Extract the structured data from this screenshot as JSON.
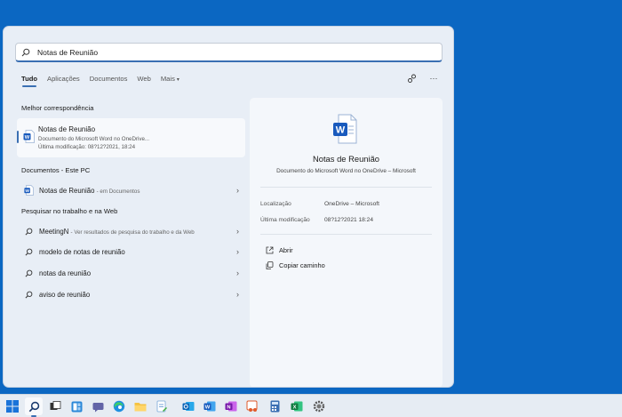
{
  "search": {
    "value": "Notas de Reunião",
    "placeholder": ""
  },
  "tabs": [
    {
      "label": "Tudo",
      "active": true
    },
    {
      "label": "Aplicações"
    },
    {
      "label": "Documentos"
    },
    {
      "label": "Web"
    },
    {
      "label": "Mais",
      "icon": "chevron-down-icon"
    }
  ],
  "tools": {
    "share_icon": "share-results-icon",
    "more_icon": "more-options-icon",
    "more_glyph": "···"
  },
  "best_match": {
    "heading": "Melhor correspondência",
    "title": "Notas de Reunião",
    "subtitle": "Documento do Microsoft Word no OneDrive...",
    "modified": "Última modificação: 08?12?2021, 18:24"
  },
  "documents": {
    "heading": "Documentos - Este PC",
    "item_title": "Notas de Reunião",
    "item_location": "- em Documentos"
  },
  "web": {
    "heading": "Pesquisar no trabalho e na Web",
    "items": [
      {
        "text": "MeetingN",
        "suffix": "- Ver resultados de pesquisa do trabalho e da Web"
      },
      {
        "text": "modelo de notas de reunião",
        "suffix": ""
      },
      {
        "text": "notas da reunião",
        "suffix": ""
      },
      {
        "text": "aviso de reunião",
        "suffix": ""
      }
    ]
  },
  "preview": {
    "title": "Notas de Reunião",
    "subtitle": "Documento do Microsoft Word no OneDrive – Microsoft",
    "location_label": "Localização",
    "location_value": "OneDrive – Microsoft",
    "modified_label": "Última modificação",
    "modified_value": "08?12?2021 18:24",
    "actions": [
      {
        "label": "Abrir",
        "icon": "open-icon"
      },
      {
        "label": "Copiar caminho",
        "icon": "copy-path-icon"
      }
    ]
  },
  "colors": {
    "desktop": "#0b67c2",
    "accent": "#3a6fb3",
    "word_blue": "#185abd",
    "excel_green": "#107c41",
    "onenote_purple": "#7719aa"
  },
  "taskbar": [
    "windows-start-icon",
    "search-icon",
    "task-view-icon",
    "widgets-icon",
    "teams-chat-icon",
    "edge-icon",
    "file-explorer-icon",
    "notepad-icon",
    "outlook-icon",
    "word-icon",
    "onenote-icon",
    "snipping-tool-icon",
    "calculator-icon",
    "excel-icon",
    "settings-icon"
  ]
}
